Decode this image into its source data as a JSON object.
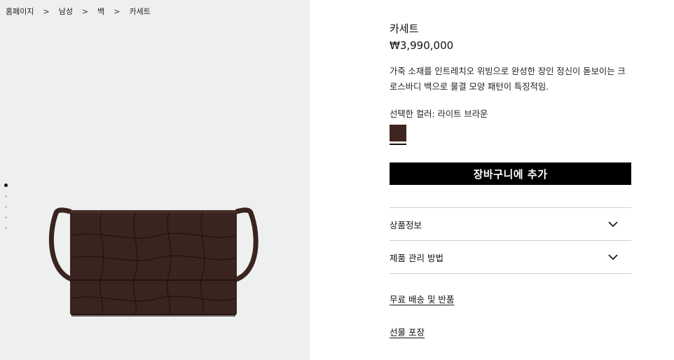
{
  "breadcrumb": {
    "items": [
      "홈페이지",
      "남성",
      "백",
      "카세트"
    ],
    "separator": ">"
  },
  "gallery": {
    "dot_count": 5,
    "active_index": 0
  },
  "product": {
    "title": "카세트",
    "price": "₩3,990,000",
    "description": "가죽 소재를 인트레치오 위빙으로 완성한 장인 정신이 돋보이는 크로스바디 백으로 물결 모양 패턴이 특징적임.",
    "color_label": "선택한 컬러: 라이트 브라운",
    "swatch_color": "#3e2520"
  },
  "actions": {
    "add_to_cart": "장바구니에 추가"
  },
  "accordion": {
    "items": [
      {
        "label": "상품정보",
        "icon": "chevron-down-icon"
      },
      {
        "label": "제품 관리 방법",
        "icon": "chevron-down-icon"
      }
    ]
  },
  "links": {
    "shipping": "무료 배송 및 반품",
    "gift": "선물 포장"
  },
  "colors": {
    "panel_bg": "#eef0ef",
    "bag": "#3a2420",
    "button_bg": "#000000"
  }
}
